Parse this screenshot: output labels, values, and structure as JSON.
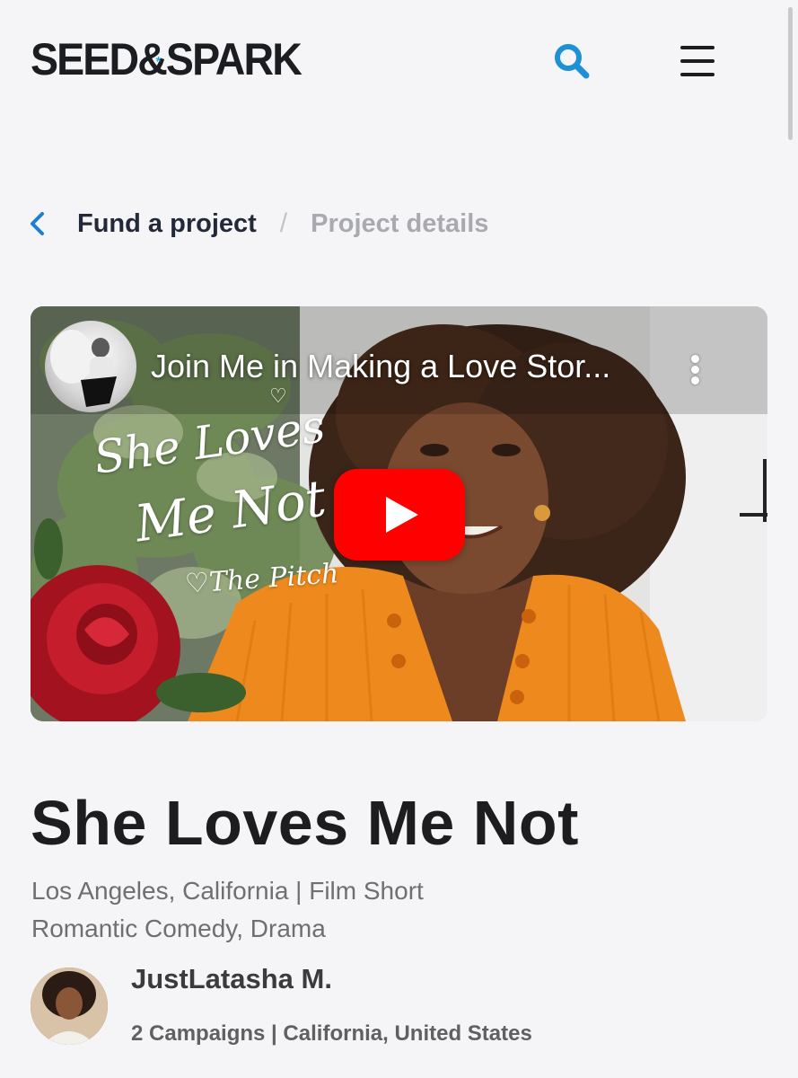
{
  "brand": {
    "logo_text_1": "SEED",
    "logo_amp": "&",
    "logo_text_2": "SPARK",
    "logo_star": "*",
    "accent": "#1e90d6"
  },
  "header": {
    "search_icon": "search-icon",
    "menu_icon": "hamburger-menu-icon"
  },
  "breadcrumb": {
    "back_icon": "chevron-left-icon",
    "parent": "Fund a project",
    "separator": "/",
    "current": "Project details"
  },
  "video": {
    "title": "Join Me in Making a Love Stor...",
    "overlay_line_1": "She Loves",
    "overlay_line_2": "Me Not",
    "overlay_line_3": "♡The Pitch",
    "heart_mark": "♡",
    "play_color": "#ff0000"
  },
  "project": {
    "title": "She Loves Me Not",
    "location_line": "Los Angeles, California | Film Short",
    "genres": "Romantic Comedy, Drama"
  },
  "creator": {
    "name": "JustLatasha M.",
    "meta": "2 Campaigns | California, United States"
  }
}
